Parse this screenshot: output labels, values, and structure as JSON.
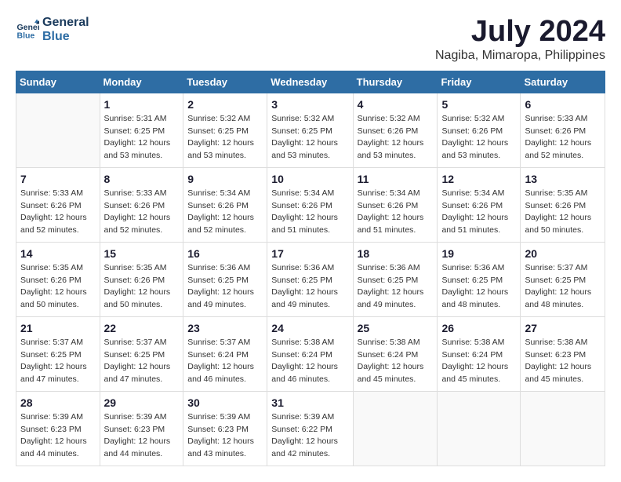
{
  "logo": {
    "line1": "General",
    "line2": "Blue"
  },
  "title": "July 2024",
  "subtitle": "Nagiba, Mimaropa, Philippines",
  "days_of_week": [
    "Sunday",
    "Monday",
    "Tuesday",
    "Wednesday",
    "Thursday",
    "Friday",
    "Saturday"
  ],
  "weeks": [
    [
      {
        "day": "",
        "sunrise": "",
        "sunset": "",
        "daylight": ""
      },
      {
        "day": "1",
        "sunrise": "Sunrise: 5:31 AM",
        "sunset": "Sunset: 6:25 PM",
        "daylight": "Daylight: 12 hours and 53 minutes."
      },
      {
        "day": "2",
        "sunrise": "Sunrise: 5:32 AM",
        "sunset": "Sunset: 6:25 PM",
        "daylight": "Daylight: 12 hours and 53 minutes."
      },
      {
        "day": "3",
        "sunrise": "Sunrise: 5:32 AM",
        "sunset": "Sunset: 6:25 PM",
        "daylight": "Daylight: 12 hours and 53 minutes."
      },
      {
        "day": "4",
        "sunrise": "Sunrise: 5:32 AM",
        "sunset": "Sunset: 6:26 PM",
        "daylight": "Daylight: 12 hours and 53 minutes."
      },
      {
        "day": "5",
        "sunrise": "Sunrise: 5:32 AM",
        "sunset": "Sunset: 6:26 PM",
        "daylight": "Daylight: 12 hours and 53 minutes."
      },
      {
        "day": "6",
        "sunrise": "Sunrise: 5:33 AM",
        "sunset": "Sunset: 6:26 PM",
        "daylight": "Daylight: 12 hours and 52 minutes."
      }
    ],
    [
      {
        "day": "7",
        "sunrise": "Sunrise: 5:33 AM",
        "sunset": "Sunset: 6:26 PM",
        "daylight": "Daylight: 12 hours and 52 minutes."
      },
      {
        "day": "8",
        "sunrise": "Sunrise: 5:33 AM",
        "sunset": "Sunset: 6:26 PM",
        "daylight": "Daylight: 12 hours and 52 minutes."
      },
      {
        "day": "9",
        "sunrise": "Sunrise: 5:34 AM",
        "sunset": "Sunset: 6:26 PM",
        "daylight": "Daylight: 12 hours and 52 minutes."
      },
      {
        "day": "10",
        "sunrise": "Sunrise: 5:34 AM",
        "sunset": "Sunset: 6:26 PM",
        "daylight": "Daylight: 12 hours and 51 minutes."
      },
      {
        "day": "11",
        "sunrise": "Sunrise: 5:34 AM",
        "sunset": "Sunset: 6:26 PM",
        "daylight": "Daylight: 12 hours and 51 minutes."
      },
      {
        "day": "12",
        "sunrise": "Sunrise: 5:34 AM",
        "sunset": "Sunset: 6:26 PM",
        "daylight": "Daylight: 12 hours and 51 minutes."
      },
      {
        "day": "13",
        "sunrise": "Sunrise: 5:35 AM",
        "sunset": "Sunset: 6:26 PM",
        "daylight": "Daylight: 12 hours and 50 minutes."
      }
    ],
    [
      {
        "day": "14",
        "sunrise": "Sunrise: 5:35 AM",
        "sunset": "Sunset: 6:26 PM",
        "daylight": "Daylight: 12 hours and 50 minutes."
      },
      {
        "day": "15",
        "sunrise": "Sunrise: 5:35 AM",
        "sunset": "Sunset: 6:26 PM",
        "daylight": "Daylight: 12 hours and 50 minutes."
      },
      {
        "day": "16",
        "sunrise": "Sunrise: 5:36 AM",
        "sunset": "Sunset: 6:25 PM",
        "daylight": "Daylight: 12 hours and 49 minutes."
      },
      {
        "day": "17",
        "sunrise": "Sunrise: 5:36 AM",
        "sunset": "Sunset: 6:25 PM",
        "daylight": "Daylight: 12 hours and 49 minutes."
      },
      {
        "day": "18",
        "sunrise": "Sunrise: 5:36 AM",
        "sunset": "Sunset: 6:25 PM",
        "daylight": "Daylight: 12 hours and 49 minutes."
      },
      {
        "day": "19",
        "sunrise": "Sunrise: 5:36 AM",
        "sunset": "Sunset: 6:25 PM",
        "daylight": "Daylight: 12 hours and 48 minutes."
      },
      {
        "day": "20",
        "sunrise": "Sunrise: 5:37 AM",
        "sunset": "Sunset: 6:25 PM",
        "daylight": "Daylight: 12 hours and 48 minutes."
      }
    ],
    [
      {
        "day": "21",
        "sunrise": "Sunrise: 5:37 AM",
        "sunset": "Sunset: 6:25 PM",
        "daylight": "Daylight: 12 hours and 47 minutes."
      },
      {
        "day": "22",
        "sunrise": "Sunrise: 5:37 AM",
        "sunset": "Sunset: 6:25 PM",
        "daylight": "Daylight: 12 hours and 47 minutes."
      },
      {
        "day": "23",
        "sunrise": "Sunrise: 5:37 AM",
        "sunset": "Sunset: 6:24 PM",
        "daylight": "Daylight: 12 hours and 46 minutes."
      },
      {
        "day": "24",
        "sunrise": "Sunrise: 5:38 AM",
        "sunset": "Sunset: 6:24 PM",
        "daylight": "Daylight: 12 hours and 46 minutes."
      },
      {
        "day": "25",
        "sunrise": "Sunrise: 5:38 AM",
        "sunset": "Sunset: 6:24 PM",
        "daylight": "Daylight: 12 hours and 45 minutes."
      },
      {
        "day": "26",
        "sunrise": "Sunrise: 5:38 AM",
        "sunset": "Sunset: 6:24 PM",
        "daylight": "Daylight: 12 hours and 45 minutes."
      },
      {
        "day": "27",
        "sunrise": "Sunrise: 5:38 AM",
        "sunset": "Sunset: 6:23 PM",
        "daylight": "Daylight: 12 hours and 45 minutes."
      }
    ],
    [
      {
        "day": "28",
        "sunrise": "Sunrise: 5:39 AM",
        "sunset": "Sunset: 6:23 PM",
        "daylight": "Daylight: 12 hours and 44 minutes."
      },
      {
        "day": "29",
        "sunrise": "Sunrise: 5:39 AM",
        "sunset": "Sunset: 6:23 PM",
        "daylight": "Daylight: 12 hours and 44 minutes."
      },
      {
        "day": "30",
        "sunrise": "Sunrise: 5:39 AM",
        "sunset": "Sunset: 6:23 PM",
        "daylight": "Daylight: 12 hours and 43 minutes."
      },
      {
        "day": "31",
        "sunrise": "Sunrise: 5:39 AM",
        "sunset": "Sunset: 6:22 PM",
        "daylight": "Daylight: 12 hours and 42 minutes."
      },
      {
        "day": "",
        "sunrise": "",
        "sunset": "",
        "daylight": ""
      },
      {
        "day": "",
        "sunrise": "",
        "sunset": "",
        "daylight": ""
      },
      {
        "day": "",
        "sunrise": "",
        "sunset": "",
        "daylight": ""
      }
    ]
  ]
}
